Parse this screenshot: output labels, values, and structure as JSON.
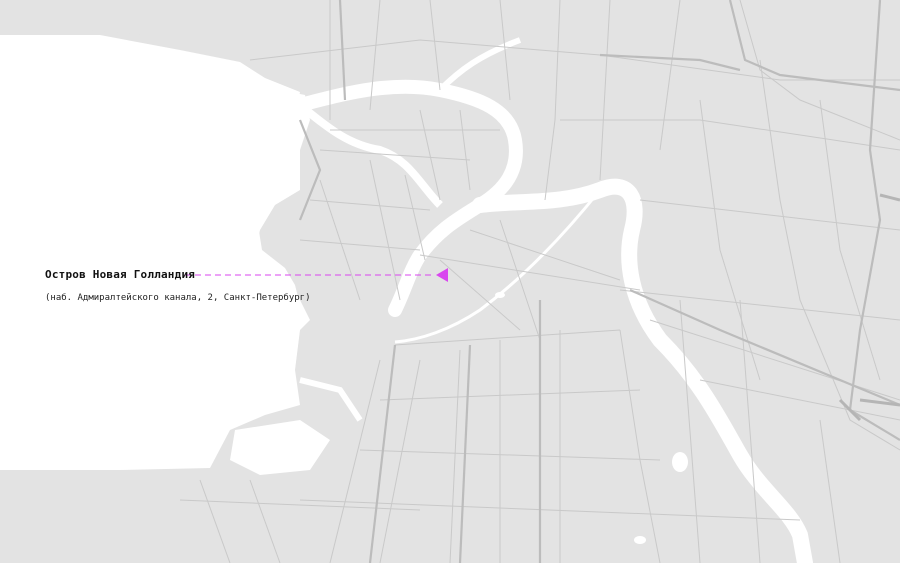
{
  "place": {
    "name": "Остров Новая Голландия",
    "address": "(наб. Адмиралтейского канала, 2, Санкт-Петербург)"
  },
  "colors": {
    "land": "#e2e2e2",
    "water": "#ffffff",
    "road": "#c8c8c8",
    "major_road": "#bdbdbd",
    "marker": "#d946ef",
    "leader": "#d946ef"
  },
  "icons": {
    "marker": "triangle-pin-icon"
  }
}
